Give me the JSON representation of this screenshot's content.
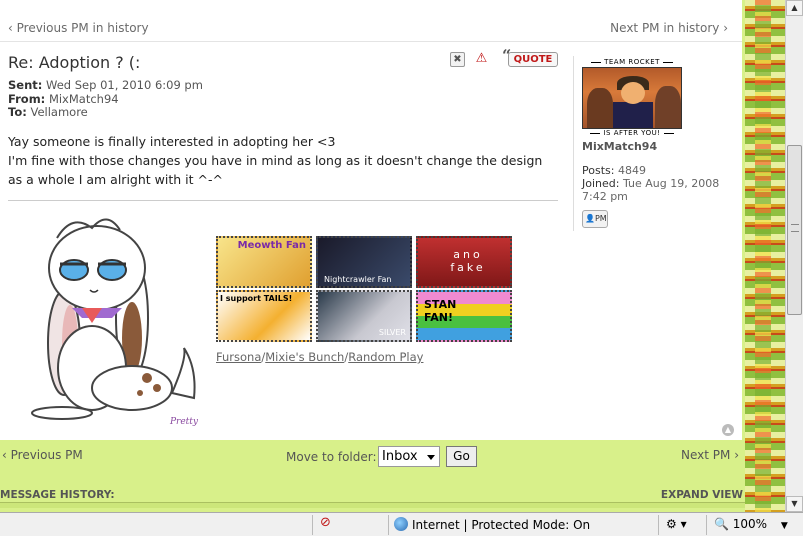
{
  "nav": {
    "prev_history": "Previous PM in history",
    "next_history": "Next PM in history",
    "prev_pm": "Previous PM",
    "next_pm": "Next PM"
  },
  "post": {
    "title": "Re: Adoption ? (:",
    "sent_label": "Sent:",
    "sent_value": "Wed Sep 01, 2010 6:09 pm",
    "from_label": "From:",
    "from_value": "MixMatch94",
    "to_label": "To:",
    "to_value": "Vellamore",
    "line1": "Yay someone is finally interested in adopting her <3",
    "line2": "I'm fine with those changes you have in mind as long as it doesn't change the design as a whole I am alright with it ^-^",
    "quote_label": "QUOTE"
  },
  "profile": {
    "rank_top": "TEAM ROCKET",
    "rank_bottom": "IS AFTER YOU!",
    "username": "MixMatch94",
    "posts_label": "Posts:",
    "posts_value": "4849",
    "joined_label": "Joined:",
    "joined_value": "Tue Aug 19, 2008 7:42 pm",
    "pm_label": "PM"
  },
  "signature": {
    "stamps": [
      "Meowth Fan",
      "Nightcrawler Fan",
      "ano fake",
      "I support TAILS!",
      "SILVER",
      "STAN FAN!"
    ],
    "stamp_fan_word": "Fan",
    "links": [
      "Fursona",
      "Mixie's Bunch",
      "Random Play"
    ],
    "artist": "Pretty"
  },
  "folder": {
    "label": "Move to folder:",
    "selected": "Inbox",
    "go": "Go"
  },
  "history": {
    "label": "MESSAGE HISTORY:",
    "expand": "EXPAND VIEW"
  },
  "statusbar": {
    "zone": "Internet | Protected Mode: On",
    "zoom": "100%"
  },
  "colors": {
    "page_bg": "#d8f08a",
    "quote_red": "#c01818"
  }
}
